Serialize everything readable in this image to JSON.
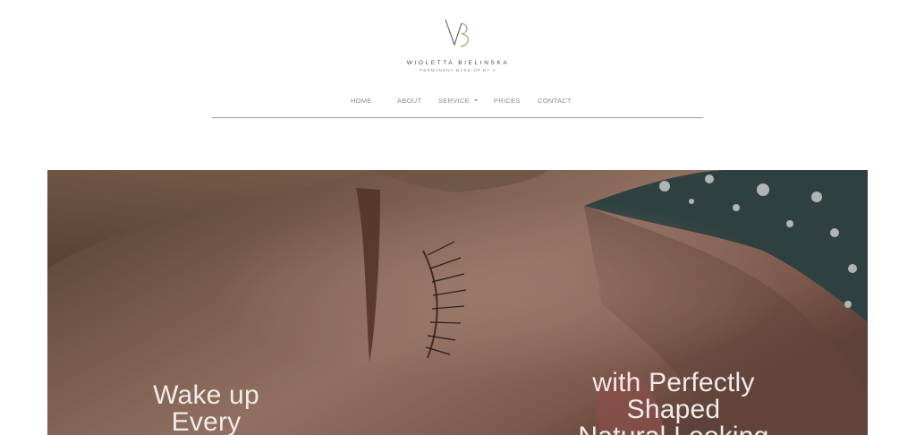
{
  "header": {
    "logo_icon": "vb-monogram-icon",
    "brand_name": "WIOLETTA BIELINSKA",
    "tagline": "PERMANENT MAKE-UP BY V"
  },
  "nav": {
    "items": [
      {
        "label": "HOME"
      },
      {
        "label": "ABOUT"
      },
      {
        "label": "SERVICE"
      },
      {
        "label": "PRICES"
      },
      {
        "label": "CONTACT"
      }
    ],
    "service_dropdown_icon": "caret-down-icon"
  },
  "hero": {
    "left_text": [
      "Wake up",
      "Every"
    ],
    "right_text": [
      "with Perfectly",
      "Shaped",
      "Natural Looking"
    ]
  },
  "colors": {
    "nav_text": "#8b8b8b",
    "divider": "#9a9a9a",
    "logo_gold": "#b8a17c",
    "hero_text": "#f1ebea"
  }
}
